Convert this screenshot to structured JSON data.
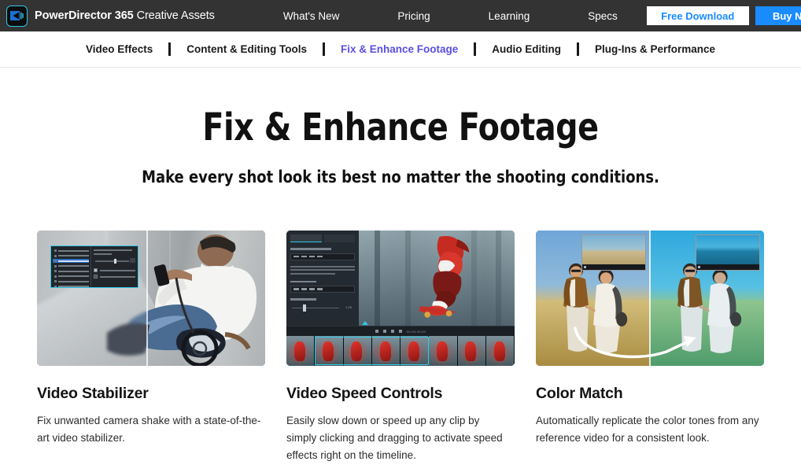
{
  "header": {
    "logo_icon": "powerdirector-logo-icon",
    "brand_bold": "PowerDirector 365",
    "brand_light": " Creative Assets",
    "nav": [
      {
        "label": "What's New"
      },
      {
        "label": "Pricing"
      },
      {
        "label": "Learning"
      },
      {
        "label": "Specs"
      }
    ],
    "free_download_label": "Free Download",
    "buy_now_label": "Buy Now",
    "background_color": "#333333",
    "free_download_text_color": "#1a8cff",
    "buy_now_color": "#1a8cff"
  },
  "subnav": {
    "active_color": "#5b4fe0",
    "items": [
      {
        "label": "Video Effects",
        "active": false
      },
      {
        "label": "Content & Editing Tools",
        "active": false
      },
      {
        "label": "Fix & Enhance Footage",
        "active": true
      },
      {
        "label": "Audio Editing",
        "active": false
      },
      {
        "label": "Plug-Ins & Performance",
        "active": false
      }
    ]
  },
  "hero": {
    "title": "Fix & Enhance Footage",
    "subtitle": "Make every shot look its best no matter the shooting conditions."
  },
  "cards": [
    {
      "title": "Video Stabilizer",
      "description": "Fix unwanted camera shake with a state-of-the-art video stabilizer.",
      "media_name": "video-stabilizer-screenshot",
      "accent_color": "#2ec8e6"
    },
    {
      "title": "Video Speed Controls",
      "description": "Easily slow down or speed up any clip by simply clicking and dragging to activate speed effects right on the timeline.",
      "media_name": "video-speed-controls-screenshot",
      "accent_color": "#2ec8e6"
    },
    {
      "title": "Color Match",
      "description": "Automatically replicate the color tones from any reference video for a consistent look.",
      "media_name": "color-match-screenshot",
      "accent_color": "#ffffff"
    }
  ]
}
